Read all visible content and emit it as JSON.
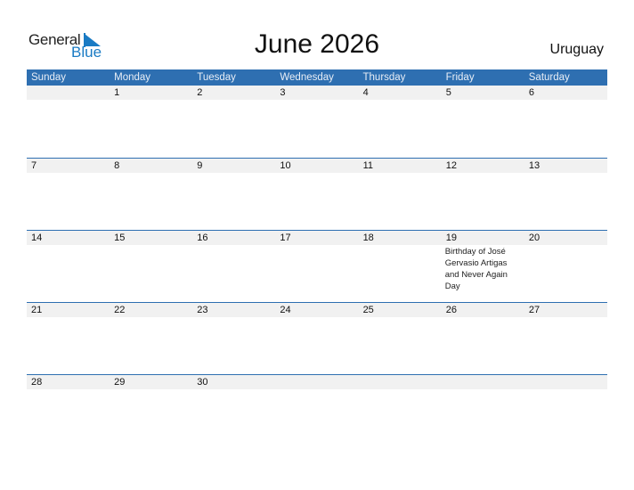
{
  "logo": {
    "general": "General",
    "blue": "Blue"
  },
  "title": "June 2026",
  "country": "Uruguay",
  "weekdays": [
    "Sunday",
    "Monday",
    "Tuesday",
    "Wednesday",
    "Thursday",
    "Friday",
    "Saturday"
  ],
  "colors": {
    "accent": "#2e6fb1",
    "logo_blue": "#1a7bc4",
    "date_strip": "#f1f1f1"
  },
  "weeks": [
    [
      {
        "d": ""
      },
      {
        "d": "1"
      },
      {
        "d": "2"
      },
      {
        "d": "3"
      },
      {
        "d": "4"
      },
      {
        "d": "5"
      },
      {
        "d": "6"
      }
    ],
    [
      {
        "d": "7"
      },
      {
        "d": "8"
      },
      {
        "d": "9"
      },
      {
        "d": "10"
      },
      {
        "d": "11"
      },
      {
        "d": "12"
      },
      {
        "d": "13"
      }
    ],
    [
      {
        "d": "14"
      },
      {
        "d": "15"
      },
      {
        "d": "16"
      },
      {
        "d": "17"
      },
      {
        "d": "18"
      },
      {
        "d": "19",
        "event": "Birthday of José Gervasio Artigas and Never Again Day"
      },
      {
        "d": "20"
      }
    ],
    [
      {
        "d": "21"
      },
      {
        "d": "22"
      },
      {
        "d": "23"
      },
      {
        "d": "24"
      },
      {
        "d": "25"
      },
      {
        "d": "26"
      },
      {
        "d": "27"
      }
    ],
    [
      {
        "d": "28"
      },
      {
        "d": "29"
      },
      {
        "d": "30"
      },
      {
        "d": ""
      },
      {
        "d": ""
      },
      {
        "d": ""
      },
      {
        "d": ""
      }
    ]
  ]
}
